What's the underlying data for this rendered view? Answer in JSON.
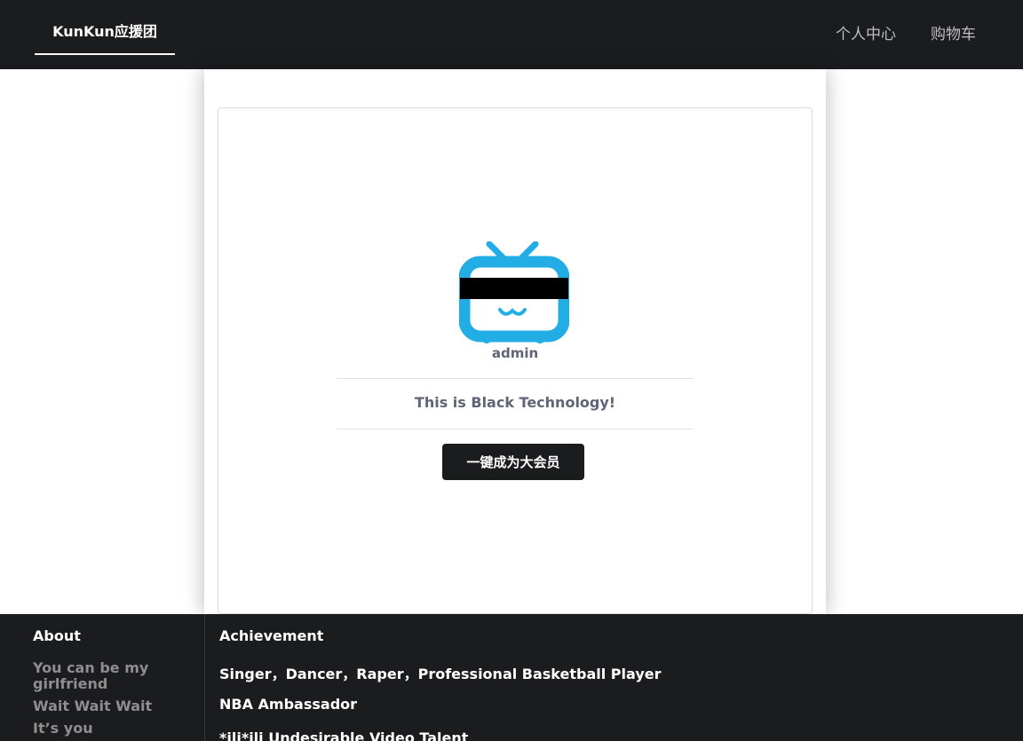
{
  "navbar": {
    "brand": "KunKun应援团",
    "links": {
      "profile": "个人中心",
      "cart": "购物车"
    }
  },
  "profile_card": {
    "username": "admin",
    "tagline": "This is Black Technology!",
    "vip_button": "一键成为大会员",
    "avatar_color": "#23ade5"
  },
  "footer": {
    "about": {
      "heading": "About",
      "items": [
        "You can be my girlfriend",
        "Wait Wait Wait",
        "It’s you"
      ]
    },
    "achievement": {
      "heading": "Achievement",
      "items": [
        "Singer，Dancer，Raper，Professional Basketball Player",
        "NBA Ambassador",
        "*ili*ili Undesirable Video Talent"
      ]
    }
  }
}
